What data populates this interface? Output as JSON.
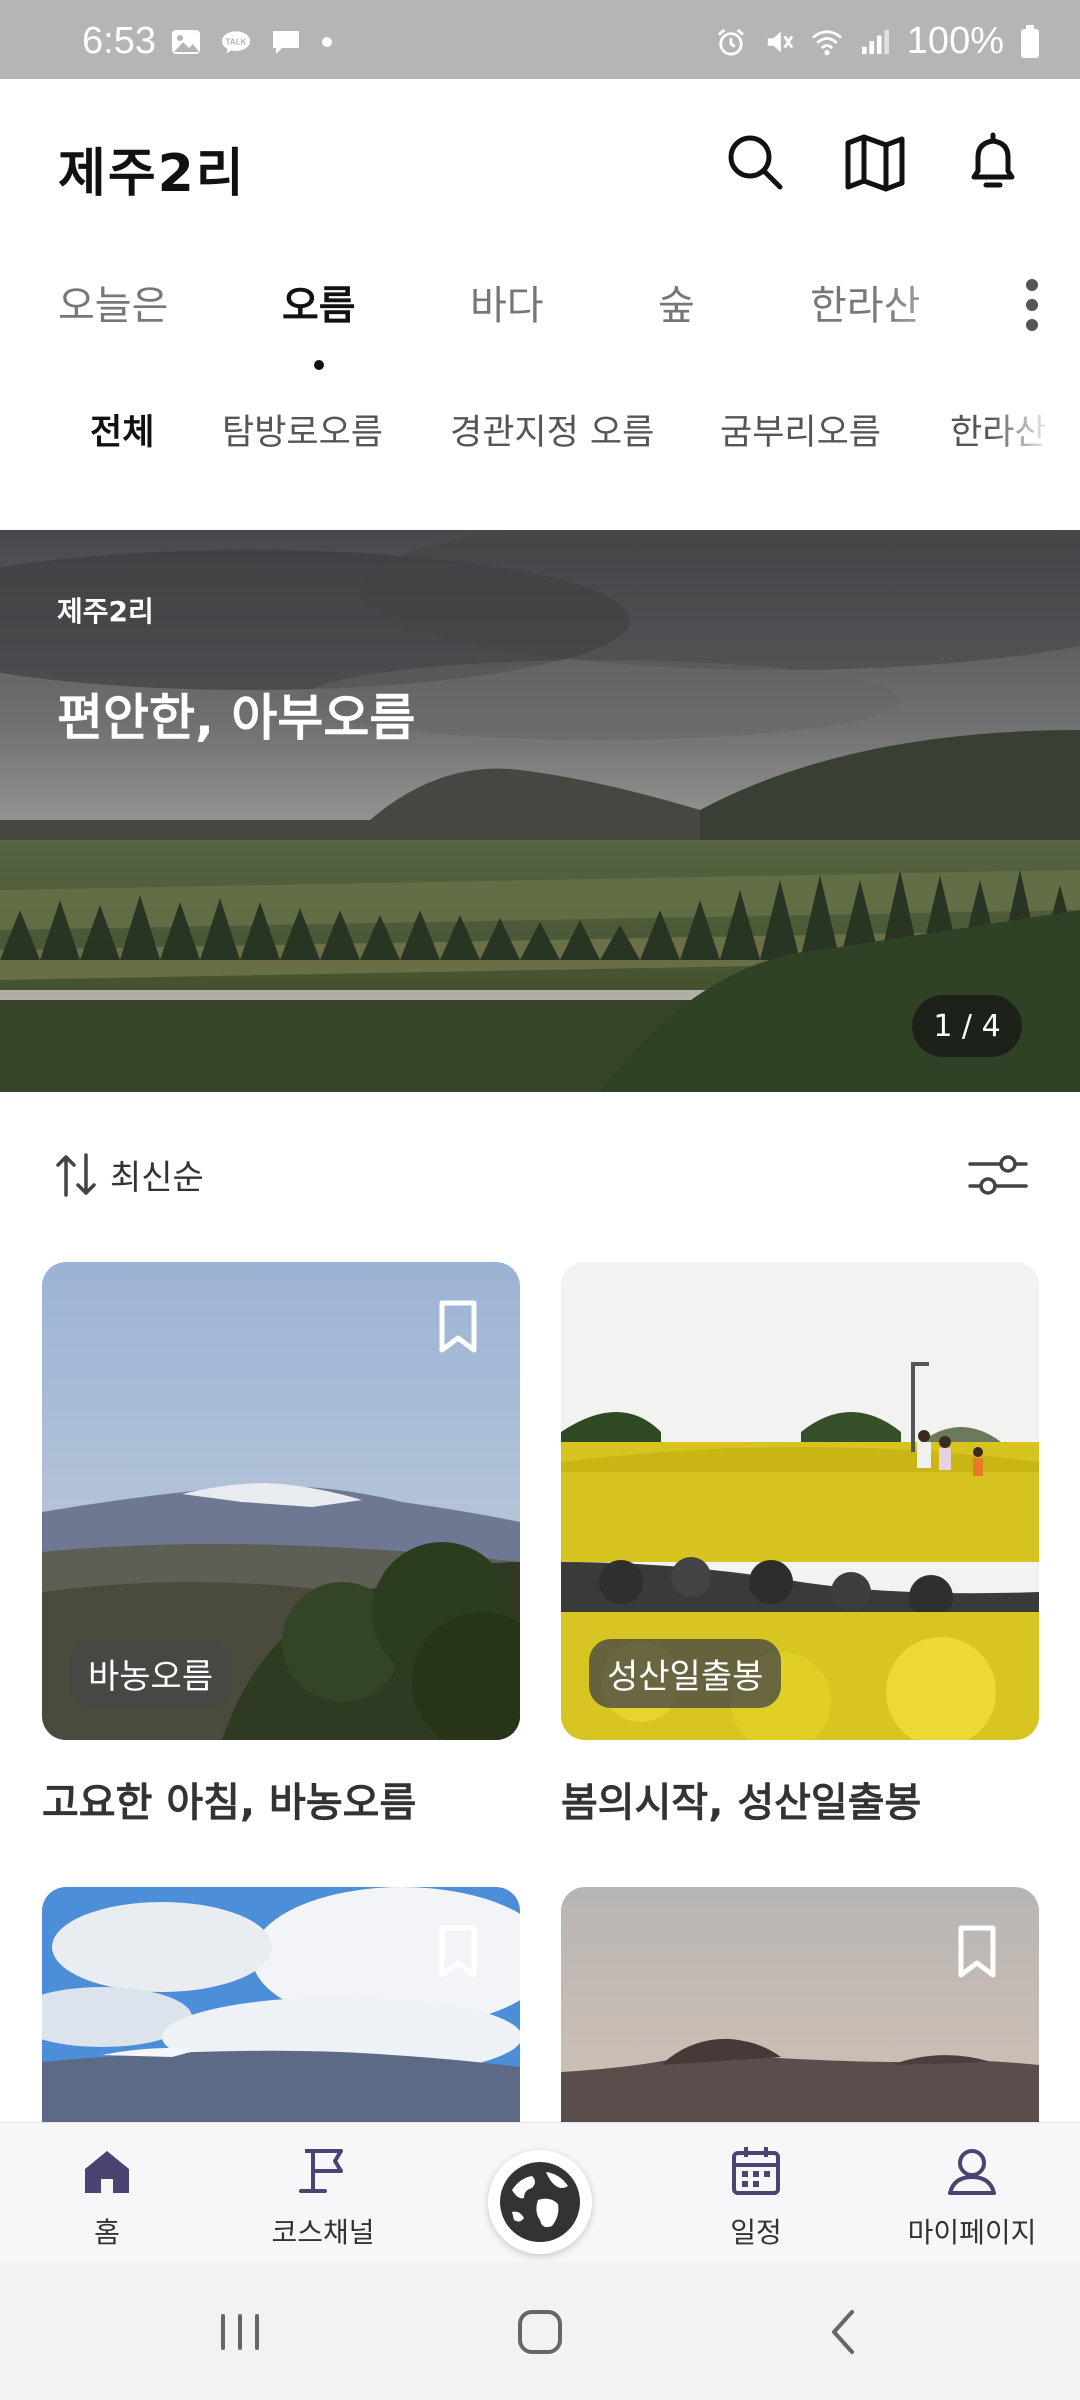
{
  "status_bar": {
    "time": "6:53",
    "battery": "100%",
    "notification_icons": [
      "gallery-icon",
      "kakaotalk-icon",
      "message-icon",
      "dot-icon"
    ],
    "system_icons": [
      "alarm-icon",
      "mute-icon",
      "wifi-icon",
      "signal-icon",
      "battery-icon"
    ]
  },
  "header": {
    "title": "제주2리",
    "icons": [
      "search-icon",
      "map-icon",
      "bell-icon"
    ]
  },
  "category_tabs": {
    "items": [
      {
        "label": "오늘은",
        "active": false
      },
      {
        "label": "오름",
        "active": true
      },
      {
        "label": "바다",
        "active": false
      },
      {
        "label": "숲",
        "active": false
      },
      {
        "label": "한라산",
        "active": false
      }
    ]
  },
  "sub_tabs": {
    "items": [
      {
        "label": "전체",
        "active": true
      },
      {
        "label": "탐방로오름",
        "active": false
      },
      {
        "label": "경관지정 오름",
        "active": false
      },
      {
        "label": "굼부리오름",
        "active": false
      },
      {
        "label": "한라산",
        "active": false
      }
    ]
  },
  "banner": {
    "label": "제주2리",
    "title": "편안한, 아부오름",
    "counter": "1 / 4"
  },
  "sort": {
    "label": "최신순"
  },
  "cards": [
    {
      "tag": "바농오름",
      "title": "고요한 아침, 바농오름"
    },
    {
      "tag": "성산일출봉",
      "title": "봄의시작, 성산일출봉"
    },
    {
      "tag": "",
      "title": ""
    },
    {
      "tag": "",
      "title": ""
    }
  ],
  "bottom_nav": {
    "items": [
      {
        "label": "홈",
        "icon": "home-icon"
      },
      {
        "label": "코스채널",
        "icon": "flag-icon"
      },
      {
        "label": "",
        "icon": "globe-icon"
      },
      {
        "label": "일정",
        "icon": "calendar-icon"
      },
      {
        "label": "마이페이지",
        "icon": "user-icon"
      }
    ]
  },
  "colors": {
    "accent_nav": "#4a4473",
    "status_bar": "#b5b5b5"
  }
}
